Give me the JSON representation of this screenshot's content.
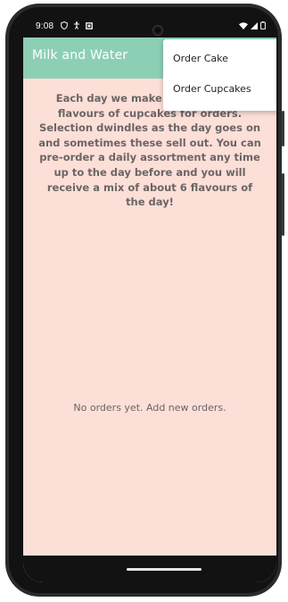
{
  "status_bar": {
    "time": "9:08",
    "left_icons": [
      "shield-icon",
      "accessibility-icon",
      "notification-square-icon"
    ],
    "right_icons": [
      "wifi-icon",
      "signal-icon",
      "battery-icon"
    ]
  },
  "app_bar": {
    "title": "Milk and Water",
    "color": "#8ccfb5"
  },
  "menu": {
    "items": [
      {
        "label": "Order Cake"
      },
      {
        "label": "Order Cupcakes"
      }
    ]
  },
  "content": {
    "info_text": "Each day we make a selection of flavours of cupcakes for orders. Selection dwindles as the day goes on and sometimes these sell out. You can pre-order a daily assortment any time up to the day before and you will receive a mix of about 6 flavours of the day!",
    "empty_text": "No orders yet. Add new orders.",
    "background": "#fcdfd7"
  }
}
